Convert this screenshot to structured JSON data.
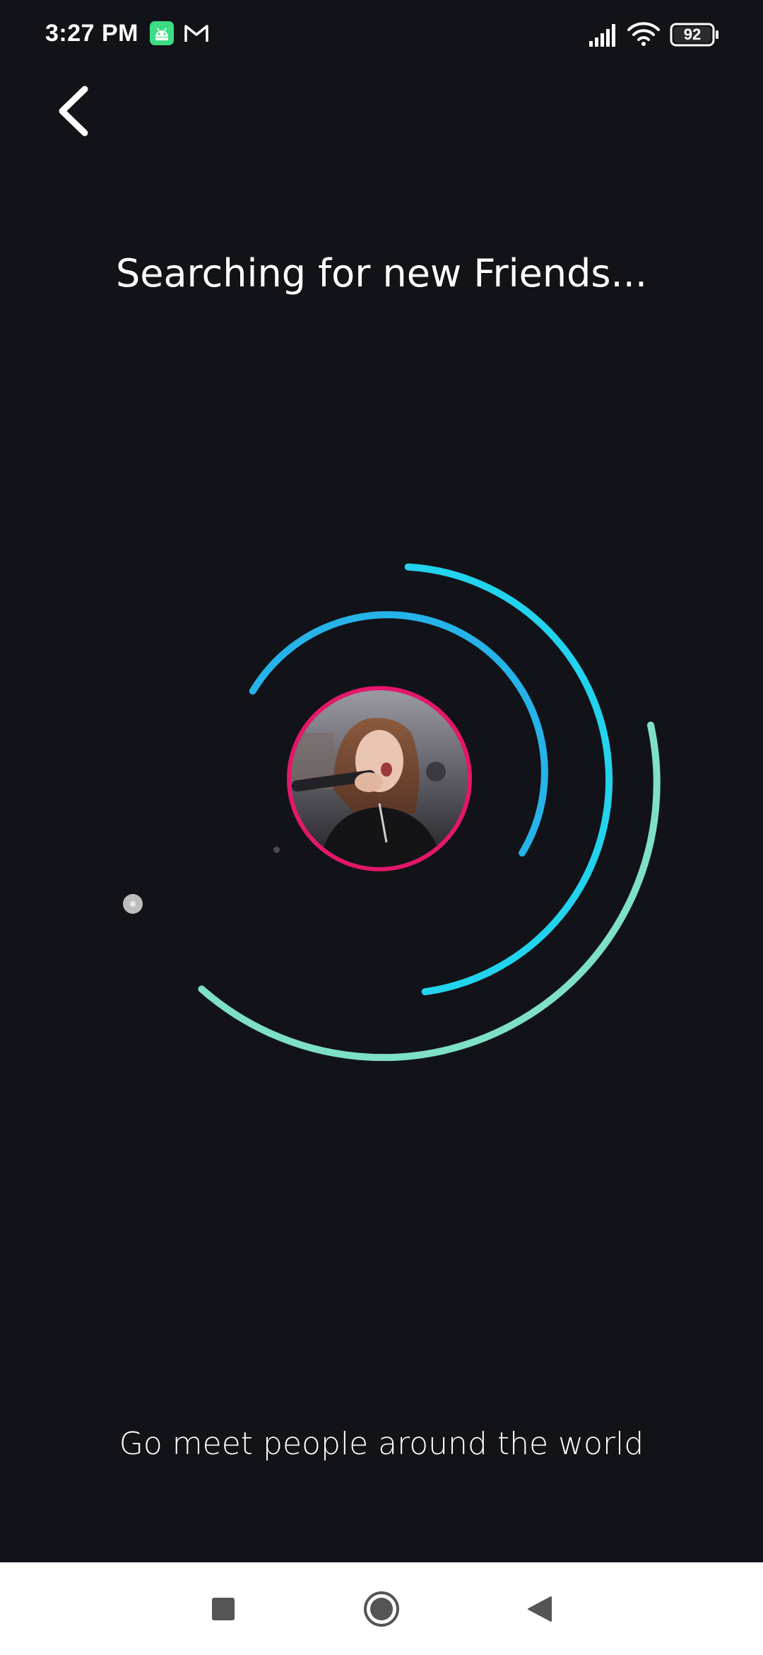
{
  "status_bar": {
    "time": "3:27 PM",
    "battery": "92",
    "icons": [
      "android-app-icon",
      "gmail-icon",
      "signal-icon",
      "wifi-icon",
      "battery-icon"
    ]
  },
  "header": {
    "back_icon": "chevron-left-icon"
  },
  "main": {
    "title": "Searching for new Friends...",
    "subtitle": "Go meet people around the world",
    "avatar_icon": "user-avatar",
    "accent_colors": {
      "avatar_ring": "#e4176a",
      "inner_arc": "#25b3ea",
      "middle_arc": "#22d3ee",
      "outer_arc": "#7ee0c6"
    }
  },
  "nav_bar": {
    "icons": [
      "recents-square-icon",
      "home-circle-icon",
      "back-triangle-icon"
    ]
  }
}
